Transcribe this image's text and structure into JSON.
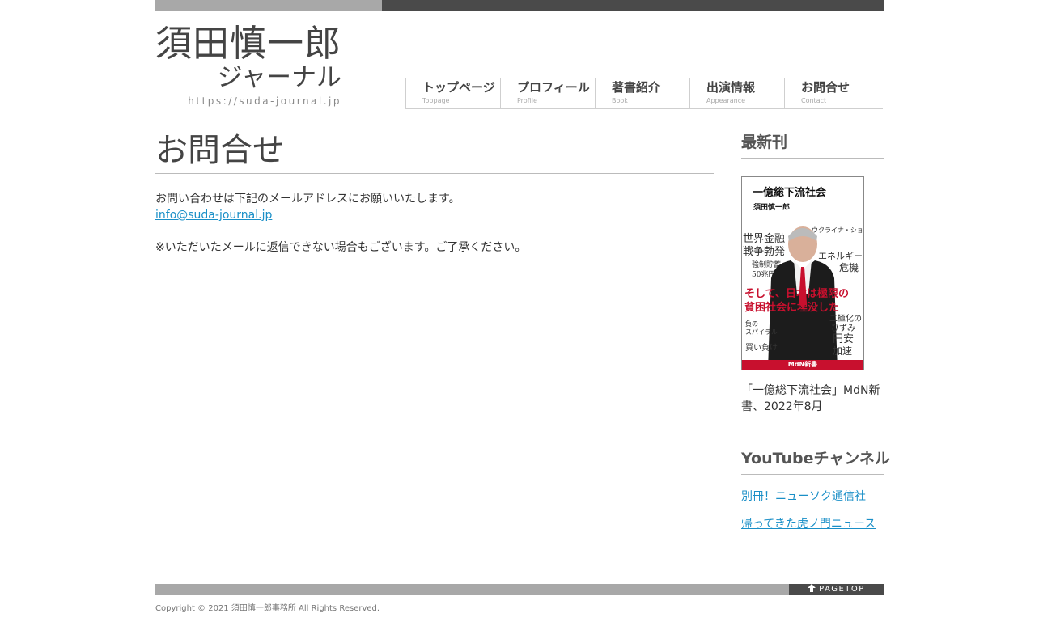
{
  "header": {
    "logo_title": "須田慎一郎",
    "logo_sub": "ジャーナル",
    "logo_url": "https://suda-journal.jp"
  },
  "nav": {
    "items": [
      {
        "ja": "トップページ",
        "en": "Toppage"
      },
      {
        "ja": "プロフィール",
        "en": "Profile"
      },
      {
        "ja": "著書紹介",
        "en": "Book"
      },
      {
        "ja": "出演情報",
        "en": "Appearance"
      },
      {
        "ja": "お問合せ",
        "en": "Contact"
      }
    ]
  },
  "main": {
    "title": "お問合せ",
    "intro": "お問い合わせは下記のメールアドレスにお願いいたします。",
    "email": "info@suda-journal.jp",
    "note": "※いただいたメールに返信できない場合もございます。ご了承ください。"
  },
  "sidebar": {
    "latest_heading": "最新刊",
    "book": {
      "cover_title": "一億総下流社会",
      "cover_author": "須田慎一郎",
      "kw1": "ウクライナ・ショック",
      "kw2": "世界金融",
      "kw3": "戦争勃発",
      "kw4": "エネルギー",
      "kw5": "危機",
      "kw6": "強制貯蓄",
      "kw7": "50兆円",
      "red_line1": "そして、日本は極限の",
      "red_line2": "貧困社会に埋没した",
      "kw8": "二極化の",
      "kw9": "ひずみ",
      "kw10": "負の",
      "kw11": "スパイラル",
      "kw12": "円安",
      "kw13": "加速",
      "kw14": "買い負け",
      "publisher": "MdN新書",
      "caption": "「一億総下流社会」MdN新書、2022年8月"
    },
    "youtube_heading": "YouTubeチャンネル",
    "youtube_links": [
      "別冊！ニューソク通信社",
      "帰ってきた虎ノ門ニュース"
    ]
  },
  "footer": {
    "pagetop": "PAGETOP",
    "pagetop_icon": "arrow-up-icon",
    "copyright": "Copyright © 2021 須田慎一郎事務所 All Rights Reserved."
  }
}
